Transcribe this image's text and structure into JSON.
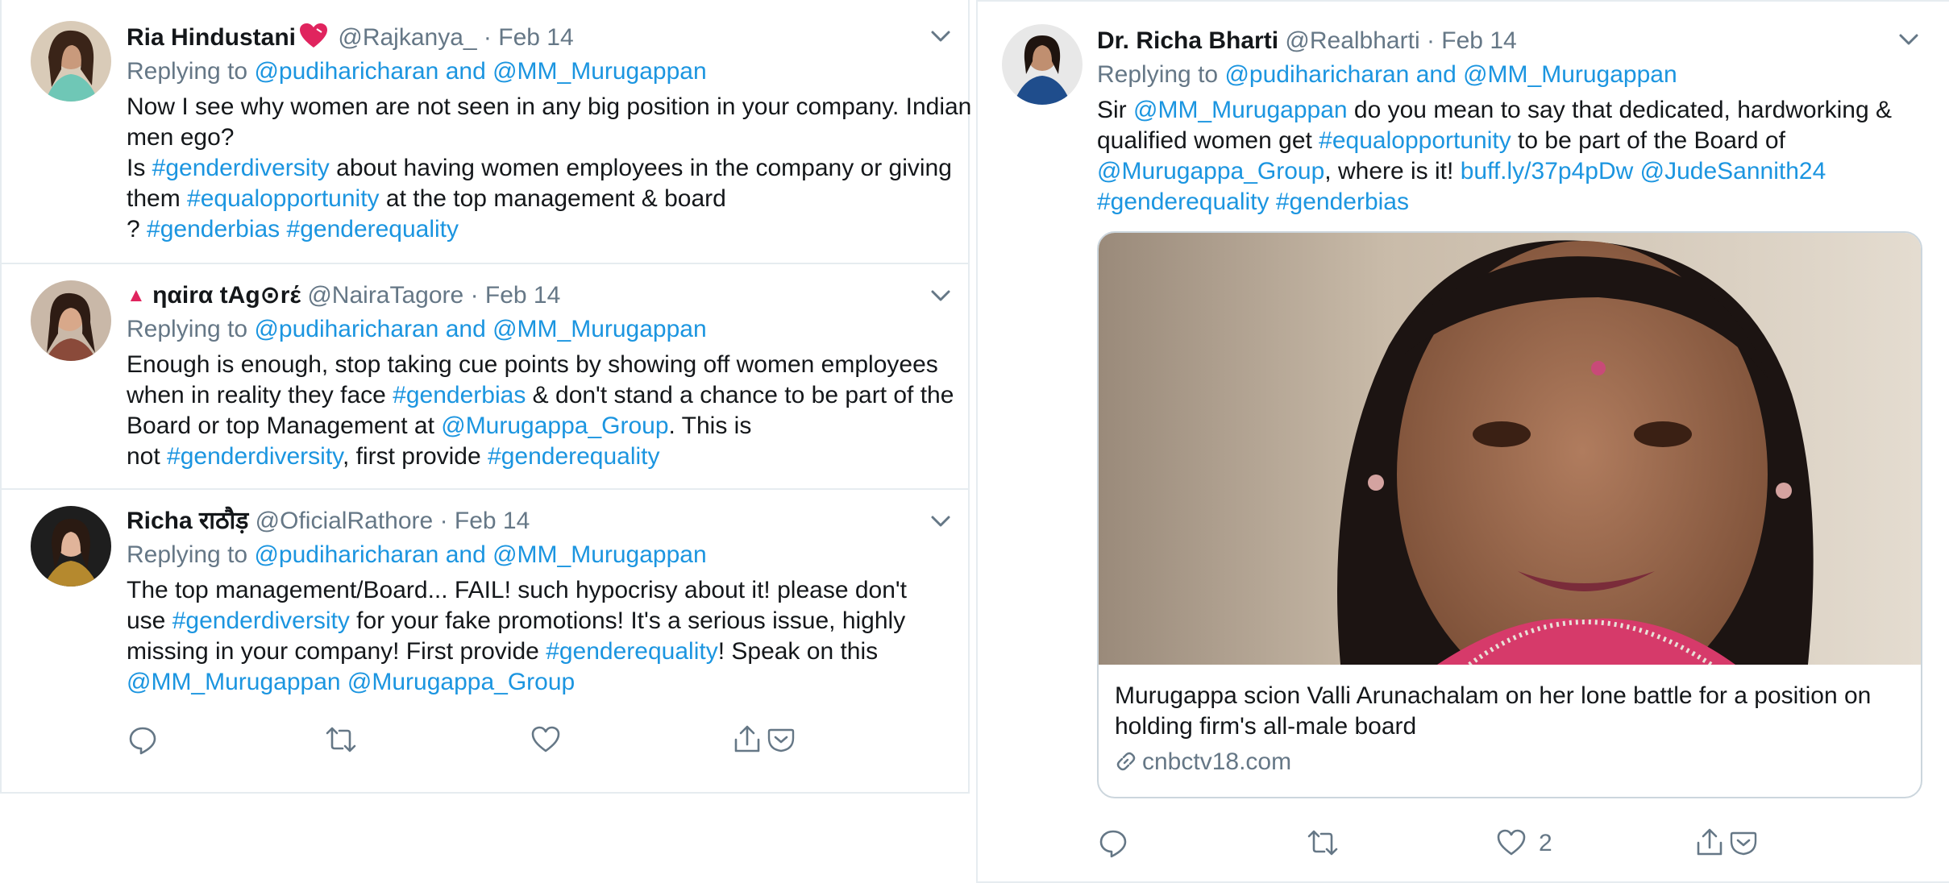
{
  "colors": {
    "link": "#1b95e0",
    "secondary": "#657786",
    "border": "#e6ecf0",
    "text": "#14171a"
  },
  "left_tweets": [
    {
      "name": "Ria Hindustani",
      "name_emoji": "heart-emoji",
      "handle": "@Rajkanya_",
      "dot": "·",
      "date": "Feb 14",
      "reply_prefix": "Replying to",
      "reply_users": "@pudiharicharan and @MM_Murugappan",
      "lines": [
        [
          {
            "t": "Now I see why women are not seen in any big position in your company. Indian",
            "link": false
          }
        ],
        [
          {
            "t": "men ego?",
            "link": false
          }
        ],
        [
          {
            "t": "Is ",
            "link": false
          },
          {
            "t": "#genderdiversity",
            "link": true
          },
          {
            "t": " about having women employees in the company or giving",
            "link": false
          }
        ],
        [
          {
            "t": "them ",
            "link": false
          },
          {
            "t": "#equalopportunity",
            "link": true
          },
          {
            "t": " at the top management & board",
            "link": false
          }
        ],
        [
          {
            "t": "? ",
            "link": false
          },
          {
            "t": "#genderbias",
            "link": true
          },
          {
            "t": " ",
            "link": false
          },
          {
            "t": "#genderequality",
            "link": true
          }
        ]
      ]
    },
    {
      "name": "ηαirα tΑg⊙rέ",
      "name_prefix_icon": "▲",
      "handle": "@NairaTagore",
      "dot": "·",
      "date": "Feb 14",
      "reply_prefix": "Replying to",
      "reply_users": "@pudiharicharan and @MM_Murugappan",
      "lines": [
        [
          {
            "t": "Enough is enough, stop taking cue points by showing off women employees",
            "link": false
          }
        ],
        [
          {
            "t": "when in reality they face ",
            "link": false
          },
          {
            "t": "#genderbias",
            "link": true
          },
          {
            "t": " & don't stand a chance to be part of the",
            "link": false
          }
        ],
        [
          {
            "t": "Board or top Management at ",
            "link": false
          },
          {
            "t": "@Murugappa_Group",
            "link": true
          },
          {
            "t": ". This is",
            "link": false
          }
        ],
        [
          {
            "t": "not ",
            "link": false
          },
          {
            "t": "#genderdiversity",
            "link": true
          },
          {
            "t": ", first provide ",
            "link": false
          },
          {
            "t": "#genderequality",
            "link": true
          }
        ]
      ]
    },
    {
      "name": "Richa राठौड़",
      "handle": "@OficialRathore",
      "dot": "·",
      "date": "Feb 14",
      "reply_prefix": "Replying to",
      "reply_users": "@pudiharicharan and @MM_Murugappan",
      "lines": [
        [
          {
            "t": "The top management/Board... FAIL! such hypocrisy about it! please don't",
            "link": false
          }
        ],
        [
          {
            "t": "use ",
            "link": false
          },
          {
            "t": "#genderdiversity",
            "link": true
          },
          {
            "t": " for your fake promotions! It's a serious issue, highly",
            "link": false
          }
        ],
        [
          {
            "t": "missing in your company! First provide ",
            "link": false
          },
          {
            "t": "#genderequality",
            "link": true
          },
          {
            "t": "! Speak on this",
            "link": false
          }
        ],
        [
          {
            "t": "@MM_Murugappan",
            "link": true
          },
          {
            "t": " ",
            "link": false
          },
          {
            "t": "@Murugappa_Group",
            "link": true
          }
        ]
      ]
    }
  ],
  "right_tweet": {
    "name": "Dr. Richa Bharti",
    "handle": "@Realbharti",
    "dot": "·",
    "date": "Feb 14",
    "reply_prefix": "Replying to",
    "reply_users": "@pudiharicharan and @MM_Murugappan",
    "lines": [
      [
        {
          "t": "Sir ",
          "link": false
        },
        {
          "t": "@MM_Murugappan",
          "link": true
        },
        {
          "t": " do you mean to say that dedicated, hardworking &",
          "link": false
        }
      ],
      [
        {
          "t": "qualified women get ",
          "link": false
        },
        {
          "t": "#equalopportunity",
          "link": true
        },
        {
          "t": " to be part of the Board of",
          "link": false
        }
      ],
      [
        {
          "t": "@Murugappa_Group",
          "link": true
        },
        {
          "t": ", where is it! ",
          "link": false
        },
        {
          "t": "buff.ly/37p4pDw",
          "link": true
        },
        {
          "t": " ",
          "link": false
        },
        {
          "t": "@JudeSannith24",
          "link": true
        }
      ],
      [
        {
          "t": " ",
          "link": false
        },
        {
          "t": "#genderequality",
          "link": true
        },
        {
          "t": " ",
          "link": false
        },
        {
          "t": "#genderbias",
          "link": true
        }
      ]
    ],
    "card": {
      "title_lines": [
        "Murugappa scion Valli Arunachalam on her lone battle for a position on",
        "holding firm's all-male board"
      ],
      "domain": "cnbctv18.com"
    },
    "like_count": "2"
  }
}
